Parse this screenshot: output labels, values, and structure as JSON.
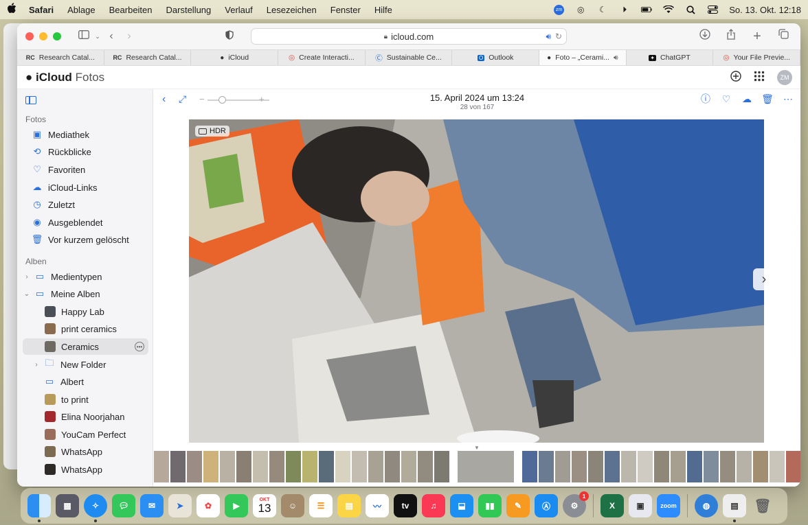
{
  "menubar": {
    "app": "Safari",
    "items": [
      "Ablage",
      "Bearbeiten",
      "Darstellung",
      "Verlauf",
      "Lesezeichen",
      "Fenster",
      "Hilfe"
    ],
    "clock": "So. 13. Okt.  12:18",
    "zoom_badge": "zm"
  },
  "browser": {
    "url": "icloud.com",
    "tabs": [
      {
        "favicon": "RC",
        "label": "Research Catal..."
      },
      {
        "favicon": "RC",
        "label": "Research Catal..."
      },
      {
        "favicon": "",
        "label": "iCloud"
      },
      {
        "favicon": "",
        "label": "Create Interacti..."
      },
      {
        "favicon": "",
        "label": "Sustainable Ce..."
      },
      {
        "favicon": "",
        "label": "Outlook"
      },
      {
        "favicon": "",
        "label": "Foto – „Cerami..."
      },
      {
        "favicon": "",
        "label": "ChatGPT"
      },
      {
        "favicon": "",
        "label": "Your File Previe..."
      }
    ],
    "active_tab": 6
  },
  "icloud": {
    "brand": "iCloud",
    "section": "Fotos",
    "avatar": "ZM"
  },
  "sidebar": {
    "photos_heading": "Fotos",
    "photos_items": [
      {
        "icon": "library-icon",
        "label": "Mediathek"
      },
      {
        "icon": "memories-icon",
        "label": "Rückblicke"
      },
      {
        "icon": "heart-icon",
        "label": "Favoriten"
      },
      {
        "icon": "cloud-icon",
        "label": "iCloud-Links"
      },
      {
        "icon": "clock-icon",
        "label": "Zuletzt"
      },
      {
        "icon": "hidden-eye-icon",
        "label": "Ausgeblendet"
      },
      {
        "icon": "trash-icon",
        "label": "Vor kurzem gelöscht"
      }
    ],
    "albums_heading": "Alben",
    "album_groups": [
      {
        "label": "Medientypen",
        "expanded": false
      },
      {
        "label": "Meine Alben",
        "expanded": true
      }
    ],
    "albums": [
      {
        "label": "Happy Lab",
        "color": "#4a4e57"
      },
      {
        "label": "print ceramics",
        "color": "#8a6b4e"
      },
      {
        "label": "Ceramics",
        "color": "#6e6a63",
        "selected": true
      },
      {
        "label": "New Folder",
        "folder": true
      },
      {
        "label": "Albert",
        "album_icon": true
      },
      {
        "label": "to print",
        "color": "#b89a5a"
      },
      {
        "label": "Elina Noorjahan",
        "color": "#a3282b"
      },
      {
        "label": "YouCam Perfect",
        "color": "#9a6c5a"
      },
      {
        "label": "WhatsApp",
        "color": "#7d6a52"
      },
      {
        "label": "WhatsApp",
        "color": "#2e2a28"
      }
    ]
  },
  "viewer": {
    "date": "15. April 2024 um 13:24",
    "position": "28 von 167",
    "hdr_label": "HDR",
    "zoom_level": 0.2
  },
  "dock": {
    "calendar_month": "OKT",
    "calendar_day": "13",
    "settings_badge": "1",
    "zoom_label": "zoom"
  }
}
